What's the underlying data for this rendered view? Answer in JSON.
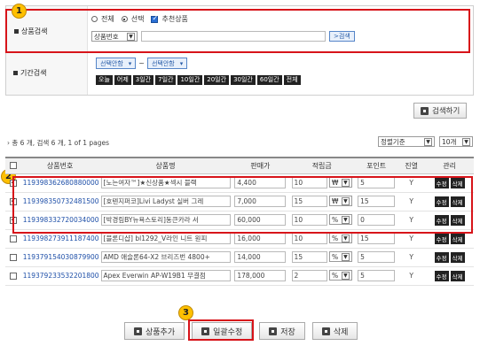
{
  "search": {
    "product_search_label": "상품검색",
    "radio_all": "전체",
    "radio_select": "선택",
    "check_recommend": "추천상품",
    "product_select": "상품번호",
    "search_input_value": "",
    "search_btn": ">검색",
    "period_label": "기간검색",
    "date_from": "선택안함",
    "date_to": "선택안함",
    "quick_buttons": [
      "오늘",
      "어제",
      "3일간",
      "7일간",
      "10일간",
      "20일간",
      "30일간",
      "60일간",
      "전체"
    ],
    "search_submit": "검색하기"
  },
  "badges": [
    "1",
    "2",
    "3"
  ],
  "summary": {
    "text": "› 총 6 개, 검색 6 개, 1 of 1 pages",
    "sort_select": "정렬기준",
    "count_select": "10개"
  },
  "table": {
    "headers": [
      "상품번호",
      "상품명",
      "판매가",
      "적립금",
      "포인트",
      "진열",
      "관리"
    ],
    "rows": [
      {
        "checked": true,
        "code": "119398362680880000",
        "name": "[노는여자™]★신상품★섹시 블랙",
        "price": "4,400",
        "reserve": "10",
        "unit": "₩",
        "point": "5",
        "display": "Y"
      },
      {
        "checked": true,
        "code": "119398350732481500",
        "name": "[호텐지퍼코]Livi Ladyst 실버 그레",
        "price": "7,000",
        "reserve": "15",
        "unit": "₩",
        "point": "15",
        "display": "Y"
      },
      {
        "checked": true,
        "code": "119398332720034000",
        "name": "[박경림BY뉴욕스토리]동큰카라 서",
        "price": "60,000",
        "reserve": "10",
        "unit": "%",
        "point": "0",
        "display": "Y"
      },
      {
        "checked": false,
        "code": "119398273911187400",
        "name": "[블론디샵] bl1292_V라인 니트 원피",
        "price": "16,000",
        "reserve": "10",
        "unit": "%",
        "point": "15",
        "display": "Y"
      },
      {
        "checked": false,
        "code": "119379154030879900",
        "name": "AMD 애슬론64-X2 브리즈번 4800+",
        "price": "14,000",
        "reserve": "15",
        "unit": "%",
        "point": "5",
        "display": "Y"
      },
      {
        "checked": false,
        "code": "119379233532201800",
        "name": "Apex Everwin AP-W19B1 무결점",
        "price": "178,000",
        "reserve": "2",
        "unit": "%",
        "point": "5",
        "display": "Y"
      }
    ],
    "edit_label": "수정",
    "delete_label": "삭제"
  },
  "footer": {
    "add_btn": "상품추가",
    "bulk_edit_btn": "일괄수정",
    "save_btn": "저장",
    "delete_btn": "삭제"
  }
}
